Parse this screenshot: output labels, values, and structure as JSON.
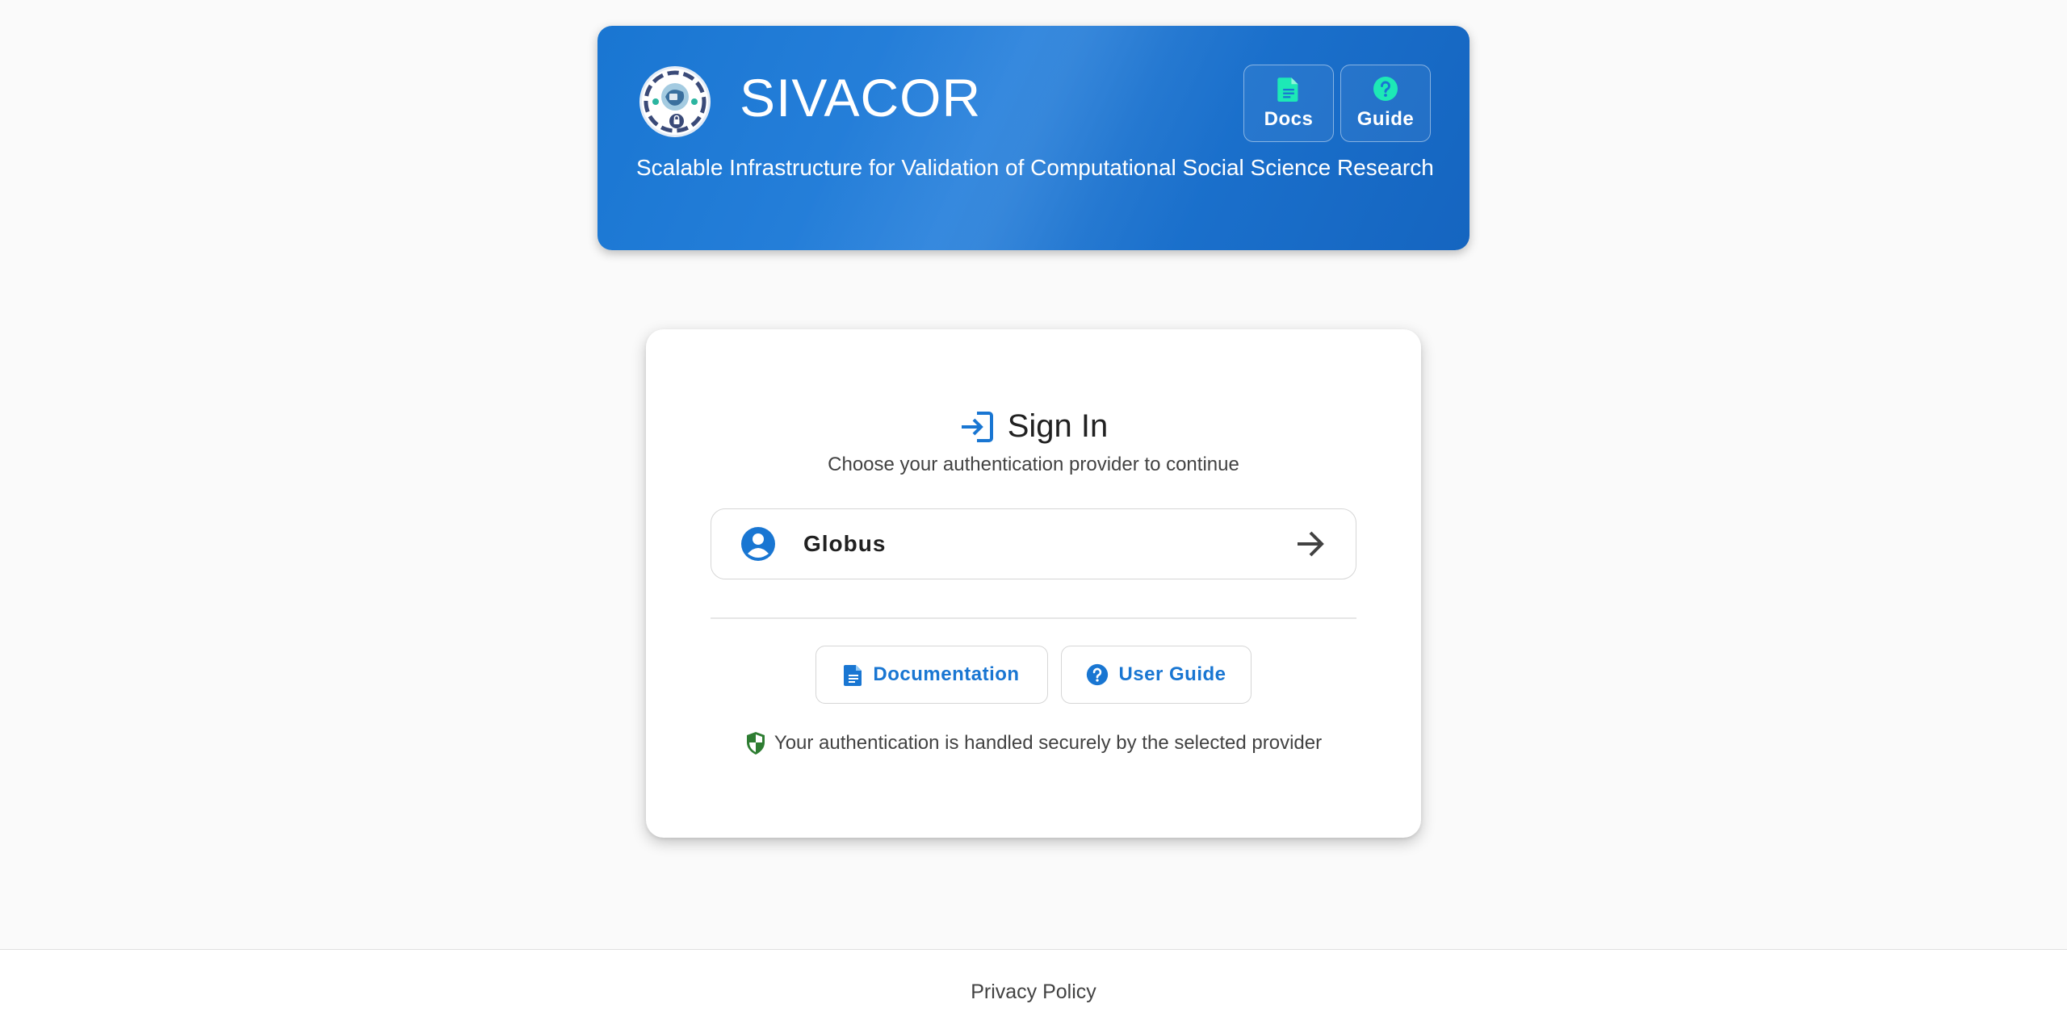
{
  "header": {
    "title": "SIVACOR",
    "subtitle": "Scalable Infrastructure for Validation of Computational Social Science Research",
    "buttons": {
      "docs": "Docs",
      "guide": "Guide"
    },
    "logo_icon": "sivacor-logo",
    "accent_color": "#1976d2",
    "icon_color": "#1de9b6"
  },
  "signin": {
    "title": "Sign In",
    "subtitle": "Choose your authentication provider to continue",
    "providers": [
      {
        "label": "Globus",
        "icon": "account-circle-icon"
      }
    ],
    "links": {
      "documentation": "Documentation",
      "user_guide": "User Guide"
    },
    "secure_note": "Your authentication is handled securely by the selected provider",
    "secure_color": "#2e7d32"
  },
  "footer": {
    "privacy": "Privacy Policy"
  }
}
